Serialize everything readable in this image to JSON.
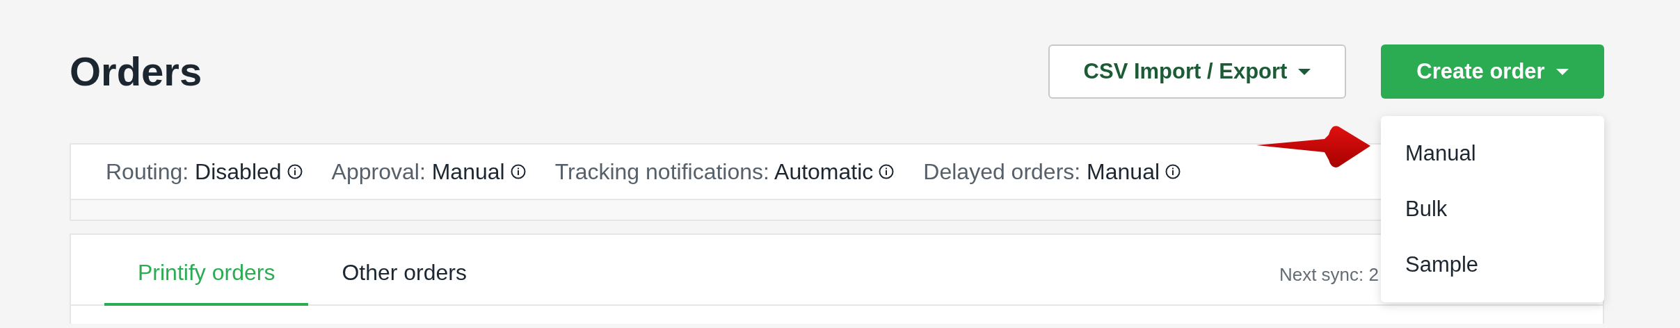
{
  "page": {
    "title": "Orders"
  },
  "csv_button": {
    "label": "CSV Import / Export"
  },
  "create_button": {
    "label": "Create order",
    "expanded": true,
    "menu": [
      {
        "label": "Manual"
      },
      {
        "label": "Bulk"
      },
      {
        "label": "Sample"
      }
    ]
  },
  "settings": [
    {
      "label": "Routing:",
      "value": "Disabled"
    },
    {
      "label": "Approval:",
      "value": "Manual"
    },
    {
      "label": "Tracking notifications:",
      "value": "Automatic"
    },
    {
      "label": "Delayed orders:",
      "value": "Manual"
    }
  ],
  "tabs": [
    {
      "label": "Printify orders",
      "selected": true
    },
    {
      "label": "Other orders",
      "selected": false
    }
  ],
  "sync": {
    "text": "Next sync: 2"
  }
}
